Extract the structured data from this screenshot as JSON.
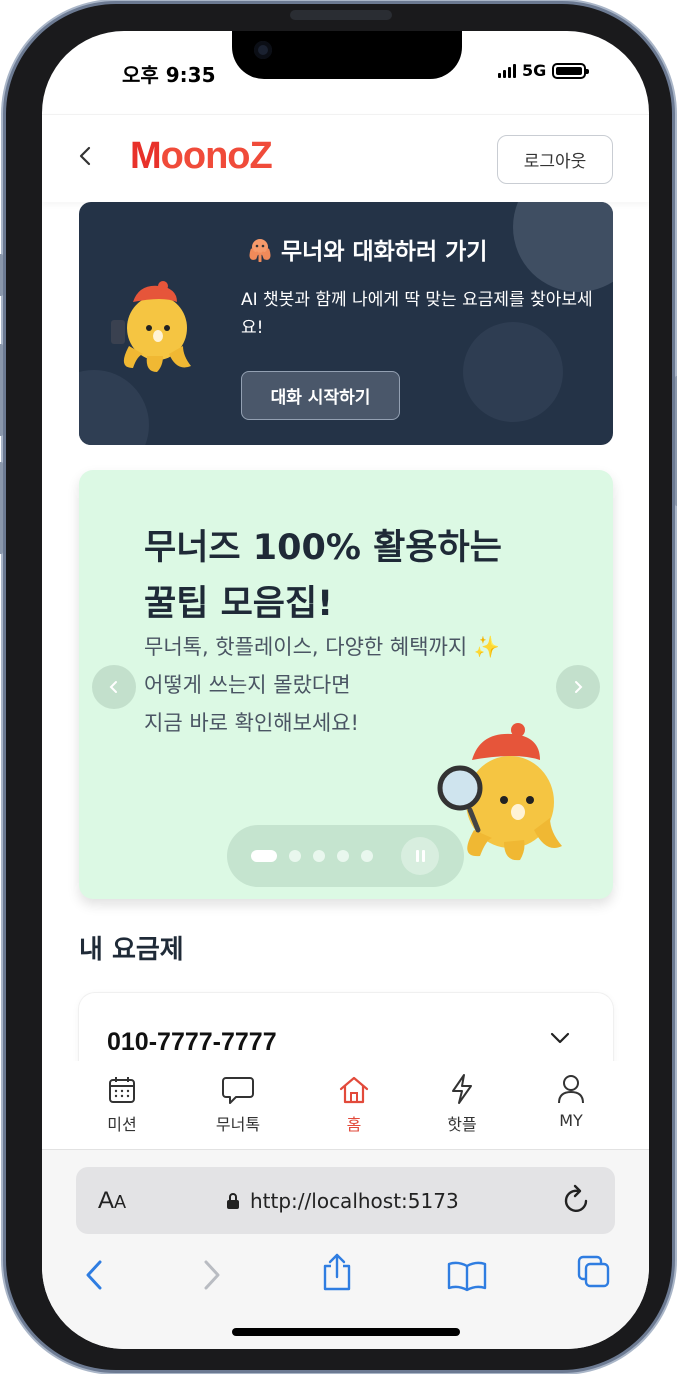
{
  "status_bar": {
    "time": "오후 9:35",
    "network": "5G"
  },
  "header": {
    "logo_initial": "M",
    "logo_rest": "oonoZ",
    "logout_label": "로그아웃"
  },
  "chat_banner": {
    "title": "무너와 대화하러 가기",
    "description": "AI 챗봇과 함께 나에게 딱 맞는 요금제를 찾아보세요!",
    "button_label": "대화 시작하기"
  },
  "promo": {
    "title": "무너즈 100% 활용하는\n꿀팁 모음집!",
    "description": "무너톡, 핫플레이스, 다양한 혜택까지 ✨\n어떻게 쓰는지 몰랐다면\n지금 바로 확인해보세요!",
    "slide_count": 5,
    "active_slide": 1
  },
  "my_plan": {
    "section_title": "내 요금제",
    "phone_number": "010-7777-7777"
  },
  "bottom_nav": [
    {
      "label": "미션",
      "icon": "calendar-icon"
    },
    {
      "label": "무너톡",
      "icon": "chat-bubble-icon"
    },
    {
      "label": "홈",
      "icon": "home-icon",
      "active": true
    },
    {
      "label": "핫플",
      "icon": "lightning-icon"
    },
    {
      "label": "MY",
      "icon": "user-icon"
    }
  ],
  "browser": {
    "text_size_label_big": "A",
    "text_size_label_small": "A",
    "url": "http://localhost:5173"
  },
  "colors": {
    "brand_red": "#e8312a",
    "banner_navy": "#243347",
    "promo_mint": "#dcf9e4",
    "safari_blue": "#2f7de1"
  }
}
